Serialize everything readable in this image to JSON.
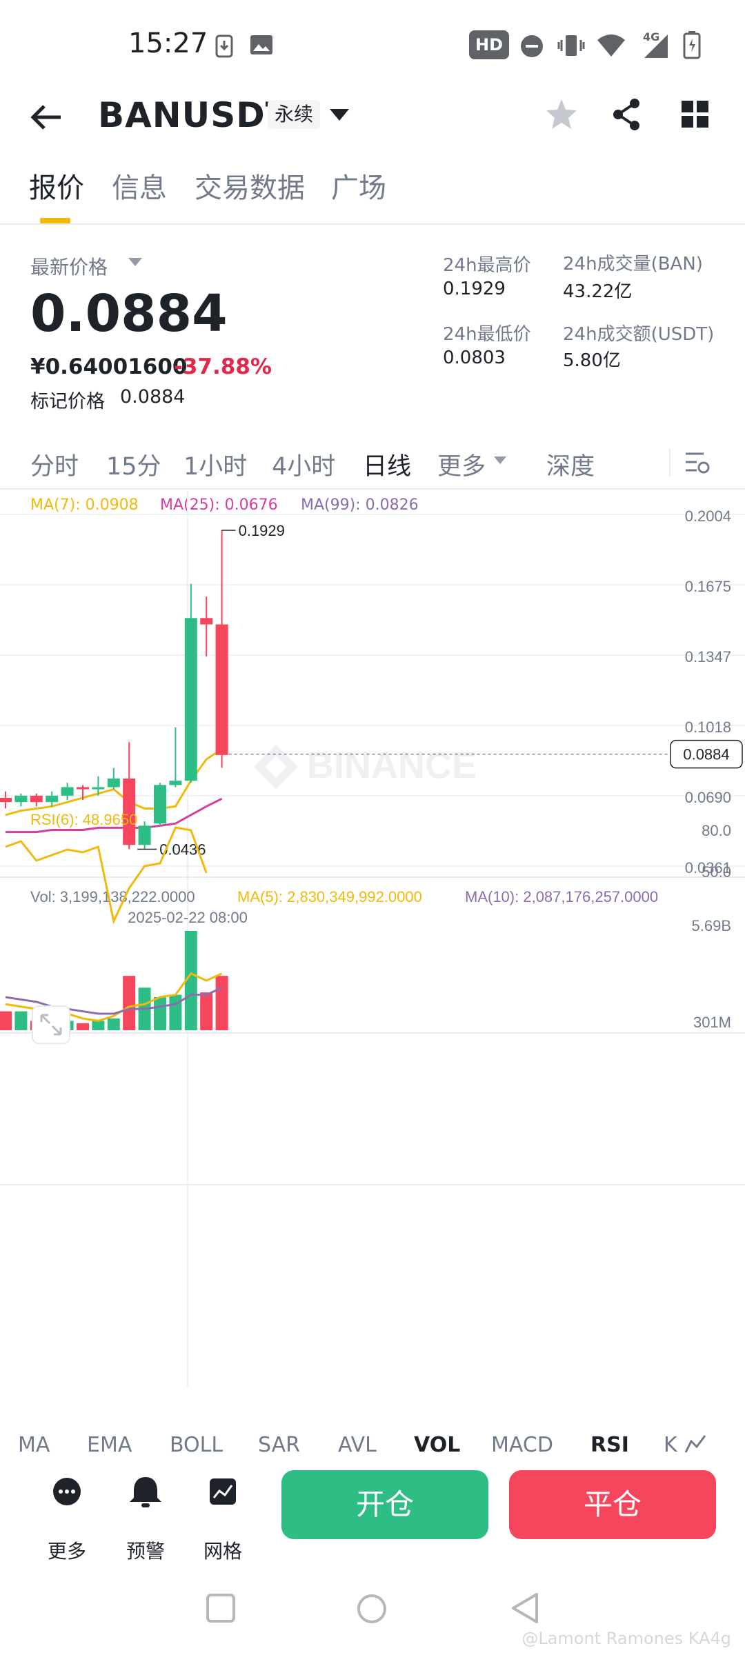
{
  "status_bar": {
    "time": "15:27",
    "icons": [
      "download-icon",
      "image-icon",
      "hd-icon",
      "dnd-icon",
      "vibrate-icon",
      "wifi-icon",
      "signal-4g-icon",
      "battery-icon"
    ],
    "hd_label": "HD",
    "network_label": "4G"
  },
  "header": {
    "symbol": "BANUSDT",
    "badge": "永续"
  },
  "tabs": [
    "报价",
    "信息",
    "交易数据",
    "广场"
  ],
  "price": {
    "last_label": "最新价格",
    "last": "0.0884",
    "cny": "¥0.64001600",
    "change": "-37.88%",
    "mark_label": "标记价格",
    "mark": "0.0884"
  },
  "stats": {
    "high_label": "24h最高价",
    "high": "0.1929",
    "low_label": "24h最低价",
    "low": "0.0803",
    "vol_label": "24h成交量(BAN)",
    "vol": "43.22亿",
    "turnover_label": "24h成交额(USDT)",
    "turnover": "5.80亿"
  },
  "intervals": [
    "分时",
    "15分",
    "1小时",
    "4小时",
    "日线",
    "更多",
    "深度"
  ],
  "ma_legend": {
    "ma7": "MA(7): 0.0908",
    "ma25": "MA(25): 0.0676",
    "ma99": "MA(99): 0.0826"
  },
  "vol_legend": {
    "vol": "Vol: 3,199,138,222.0000",
    "ma5": "MA(5): 2,830,349,992.0000",
    "ma10": "MA(10): 2,087,176,257.0000"
  },
  "rsi_legend": "RSI(6): 48.9650",
  "watermark_logo": "BINANCE",
  "colors": {
    "up": "#2ebd85",
    "down": "#f6465d",
    "ma7": "#f0b90b",
    "ma25": "#d33ea0",
    "ma99": "#8c6bb1",
    "accent": "#f0b90b"
  },
  "chart_data": {
    "type": "candlestick",
    "price_axis_ticks": [
      "0.2004",
      "0.1675",
      "0.1347",
      "0.1018",
      "0.0690",
      "0.0361"
    ],
    "price_ylim": [
      0.0361,
      0.2004
    ],
    "current_price_tag": "0.0884",
    "high_annotation": "0.1929",
    "low_annotation": "0.0436",
    "x_label": "2025-02-22 08:00",
    "candles": [
      {
        "o": 0.068,
        "h": 0.071,
        "l": 0.063,
        "c": 0.066
      },
      {
        "o": 0.066,
        "h": 0.07,
        "l": 0.064,
        "c": 0.069
      },
      {
        "o": 0.069,
        "h": 0.07,
        "l": 0.064,
        "c": 0.066
      },
      {
        "o": 0.066,
        "h": 0.071,
        "l": 0.064,
        "c": 0.069
      },
      {
        "o": 0.069,
        "h": 0.075,
        "l": 0.067,
        "c": 0.073
      },
      {
        "o": 0.073,
        "h": 0.074,
        "l": 0.067,
        "c": 0.072
      },
      {
        "o": 0.072,
        "h": 0.078,
        "l": 0.069,
        "c": 0.073
      },
      {
        "o": 0.073,
        "h": 0.082,
        "l": 0.072,
        "c": 0.077
      },
      {
        "o": 0.077,
        "h": 0.094,
        "l": 0.044,
        "c": 0.046
      },
      {
        "o": 0.046,
        "h": 0.057,
        "l": 0.044,
        "c": 0.055
      },
      {
        "o": 0.056,
        "h": 0.075,
        "l": 0.055,
        "c": 0.074
      },
      {
        "o": 0.074,
        "h": 0.101,
        "l": 0.073,
        "c": 0.076
      },
      {
        "o": 0.076,
        "h": 0.168,
        "l": 0.075,
        "c": 0.152
      },
      {
        "o": 0.152,
        "h": 0.162,
        "l": 0.134,
        "c": 0.149
      },
      {
        "o": 0.149,
        "h": 0.193,
        "l": 0.082,
        "c": 0.088
      }
    ],
    "ma7_line": [
      0.06,
      0.062,
      0.063,
      0.064,
      0.066,
      0.068,
      0.07,
      0.072,
      0.066,
      0.063,
      0.063,
      0.064,
      0.076,
      0.086,
      0.0908
    ],
    "ma25_line": [
      0.052,
      0.052,
      0.052,
      0.053,
      0.053,
      0.053,
      0.054,
      0.054,
      0.054,
      0.054,
      0.055,
      0.056,
      0.06,
      0.064,
      0.0676
    ],
    "volume_axis_ticks": [
      "5.69B",
      "301M"
    ],
    "volumes": [
      0.8,
      0.8,
      0.4,
      0.4,
      0.4,
      0.3,
      0.4,
      0.5,
      2.3,
      1.8,
      1.4,
      1.5,
      4.2,
      1.6,
      2.3
    ],
    "vol_ma5": [
      1.1,
      1.0,
      0.9,
      0.8,
      0.7,
      0.5,
      0.4,
      0.6,
      1.0,
      1.1,
      1.4,
      1.5,
      2.4,
      2.1,
      2.4
    ],
    "vol_ma10": [
      1.4,
      1.3,
      1.2,
      1.0,
      0.9,
      0.8,
      0.7,
      0.7,
      0.9,
      0.9,
      1.0,
      1.1,
      1.5,
      1.5,
      1.8
    ],
    "rsi_axis_ticks": [
      "80.0",
      "50.0"
    ],
    "rsi": [
      68,
      72,
      58,
      62,
      66,
      64,
      68,
      14,
      38,
      54,
      56,
      82,
      80,
      49
    ]
  },
  "indicators": [
    "MA",
    "EMA",
    "BOLL",
    "SAR",
    "AVL",
    "VOL",
    "MACD",
    "RSI",
    "K"
  ],
  "actions": {
    "more": "更多",
    "alert": "预警",
    "grid": "网格",
    "open": "开仓",
    "close": "平仓"
  },
  "watermark_user": "@Lamont Ramones KA4g"
}
